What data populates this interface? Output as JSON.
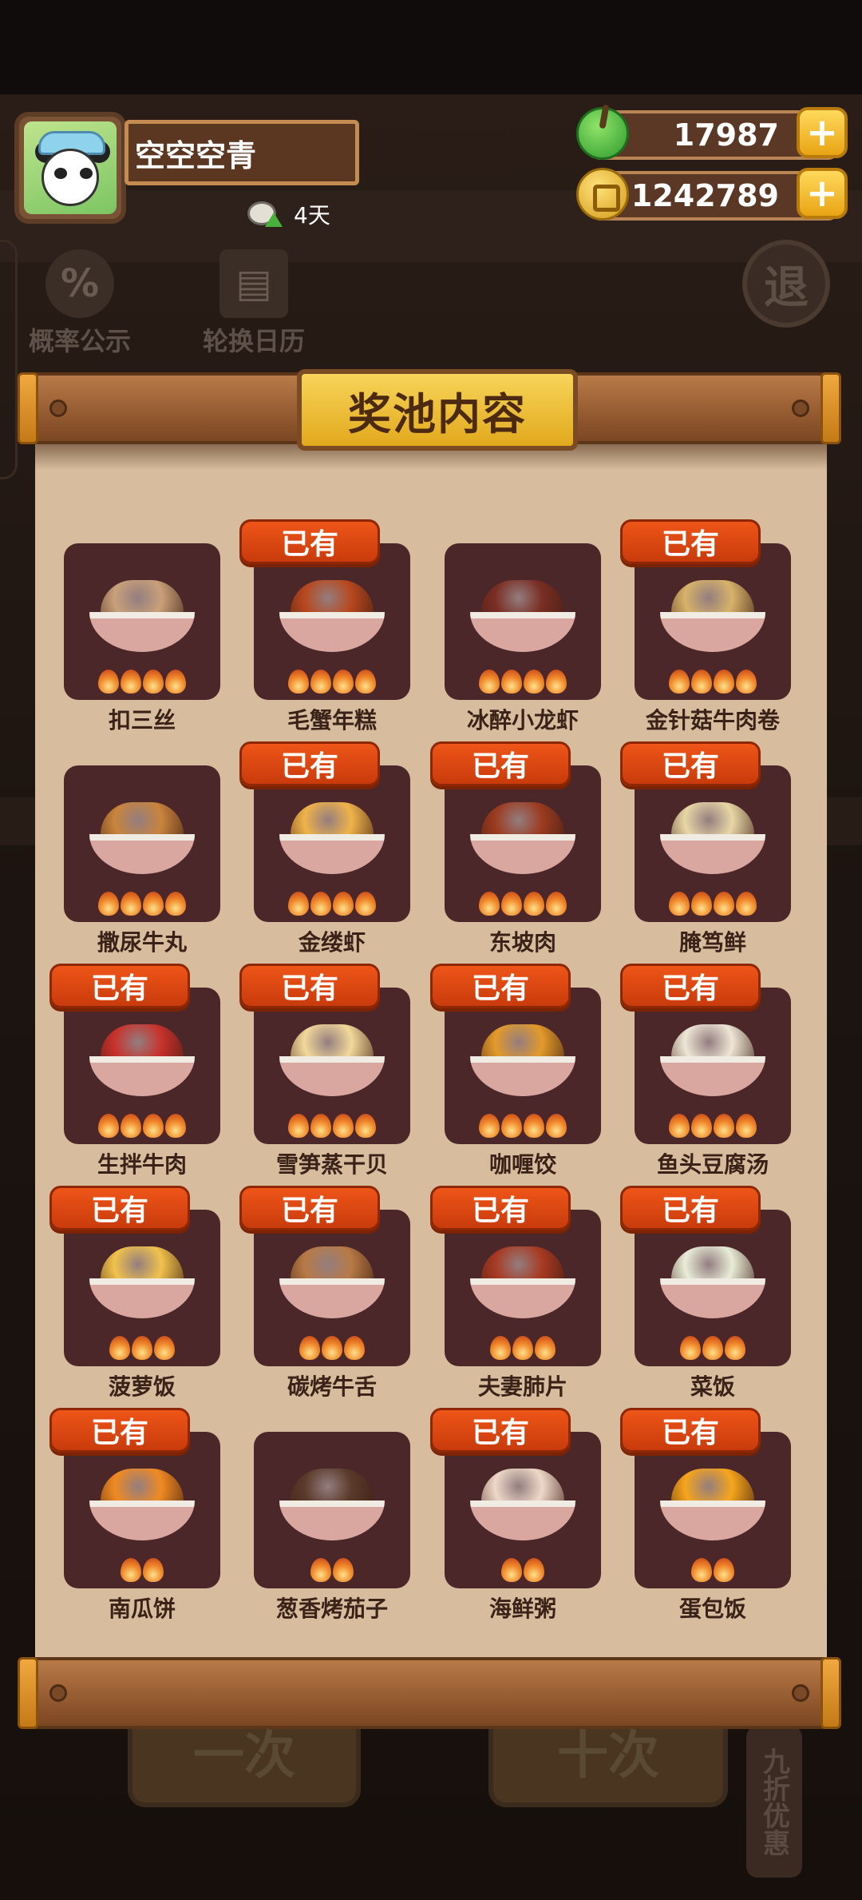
{
  "player": {
    "name": "空空空青",
    "timer": "4天"
  },
  "currency": {
    "jade": "17987",
    "coins": "1242789"
  },
  "background": {
    "probability_label": "概率公示",
    "calendar_label": "轮换日历",
    "exit_label": "退",
    "single_draw": "一次",
    "ten_draw": "十次",
    "discount": "九折优惠"
  },
  "panel": {
    "title": "奖池内容"
  },
  "owned_label": "已有",
  "dishes": [
    {
      "name": "扣三丝",
      "owned": false,
      "flames": 4,
      "color": "#c9a07a"
    },
    {
      "name": "毛蟹年糕",
      "owned": true,
      "flames": 4,
      "color": "#b8481e"
    },
    {
      "name": "冰醉小龙虾",
      "owned": false,
      "flames": 4,
      "color": "#7a2e24"
    },
    {
      "name": "金针菇牛肉卷",
      "owned": true,
      "flames": 4,
      "color": "#d7b26a"
    },
    {
      "name": "撒尿牛丸",
      "owned": false,
      "flames": 4,
      "color": "#c9843c"
    },
    {
      "name": "金缕虾",
      "owned": true,
      "flames": 4,
      "color": "#f0b34a"
    },
    {
      "name": "东坡肉",
      "owned": true,
      "flames": 4,
      "color": "#9c3b20"
    },
    {
      "name": "腌笃鲜",
      "owned": true,
      "flames": 4,
      "color": "#e8d6a6"
    },
    {
      "name": "生拌牛肉",
      "owned": true,
      "flames": 4,
      "color": "#c8322c"
    },
    {
      "name": "雪笋蒸干贝",
      "owned": true,
      "flames": 4,
      "color": "#f2d89a"
    },
    {
      "name": "咖喱饺",
      "owned": true,
      "flames": 4,
      "color": "#e39a2a"
    },
    {
      "name": "鱼头豆腐汤",
      "owned": true,
      "flames": 4,
      "color": "#eee6d6"
    },
    {
      "name": "菠萝饭",
      "owned": true,
      "flames": 3,
      "color": "#f1c24c"
    },
    {
      "name": "碳烤牛舌",
      "owned": true,
      "flames": 3,
      "color": "#b87a45"
    },
    {
      "name": "夫妻肺片",
      "owned": true,
      "flames": 3,
      "color": "#a83a22"
    },
    {
      "name": "菜饭",
      "owned": true,
      "flames": 3,
      "color": "#e9ecd8"
    },
    {
      "name": "南瓜饼",
      "owned": true,
      "flames": 2,
      "color": "#f08a22"
    },
    {
      "name": "葱香烤茄子",
      "owned": false,
      "flames": 2,
      "color": "#5a3a2a"
    },
    {
      "name": "海鲜粥",
      "owned": true,
      "flames": 2,
      "color": "#efd8c8"
    },
    {
      "name": "蛋包饭",
      "owned": true,
      "flames": 2,
      "color": "#f6a51c"
    }
  ]
}
